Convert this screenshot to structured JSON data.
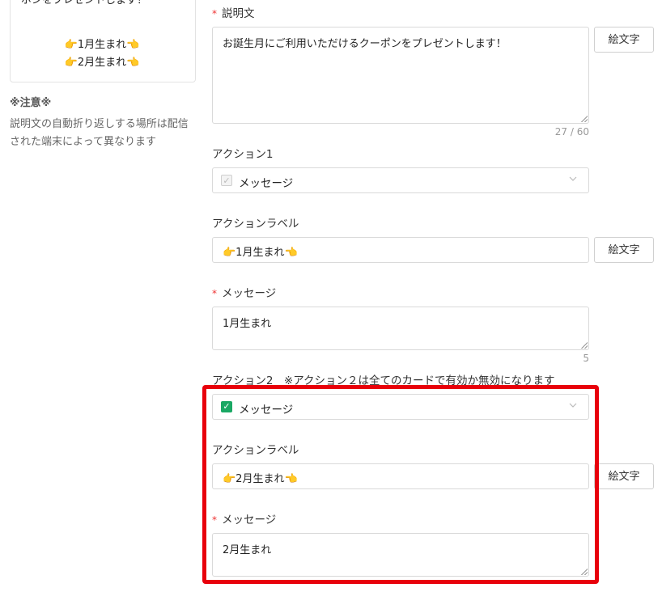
{
  "preview": {
    "top_text": "ーポンをプレゼントします！",
    "line1": "👉1月生まれ👈",
    "line2": "👉2月生まれ👈"
  },
  "note": {
    "title": "※注意※",
    "text": "説明文の自動折り返しする場所は配信された端末によって異なります"
  },
  "description": {
    "label": "説明文",
    "value": "お誕生月にご利用いただけるクーポンをプレゼントします！",
    "counter": "27 / 60",
    "emoji_button": "絵文字"
  },
  "action1": {
    "label": "アクション1",
    "type": "メッセージ",
    "action_label_title": "アクションラベル",
    "action_label_value": "👉1月生まれ👈",
    "emoji_button": "絵文字",
    "message_label": "メッセージ",
    "message_value": "1月生まれ",
    "counter": "5"
  },
  "action2": {
    "label": "アクション2　※アクション２は全てのカードで有効か無効になります",
    "type": "メッセージ",
    "checked": true,
    "action_label_title": "アクションラベル",
    "action_label_value": "👉2月生まれ👈",
    "emoji_button": "絵文字",
    "message_label": "メッセージ",
    "message_value": "2月生まれ"
  },
  "colors": {
    "highlight": "#e8000b",
    "checkbox_on": "#1aa864",
    "required": "#e33333"
  }
}
